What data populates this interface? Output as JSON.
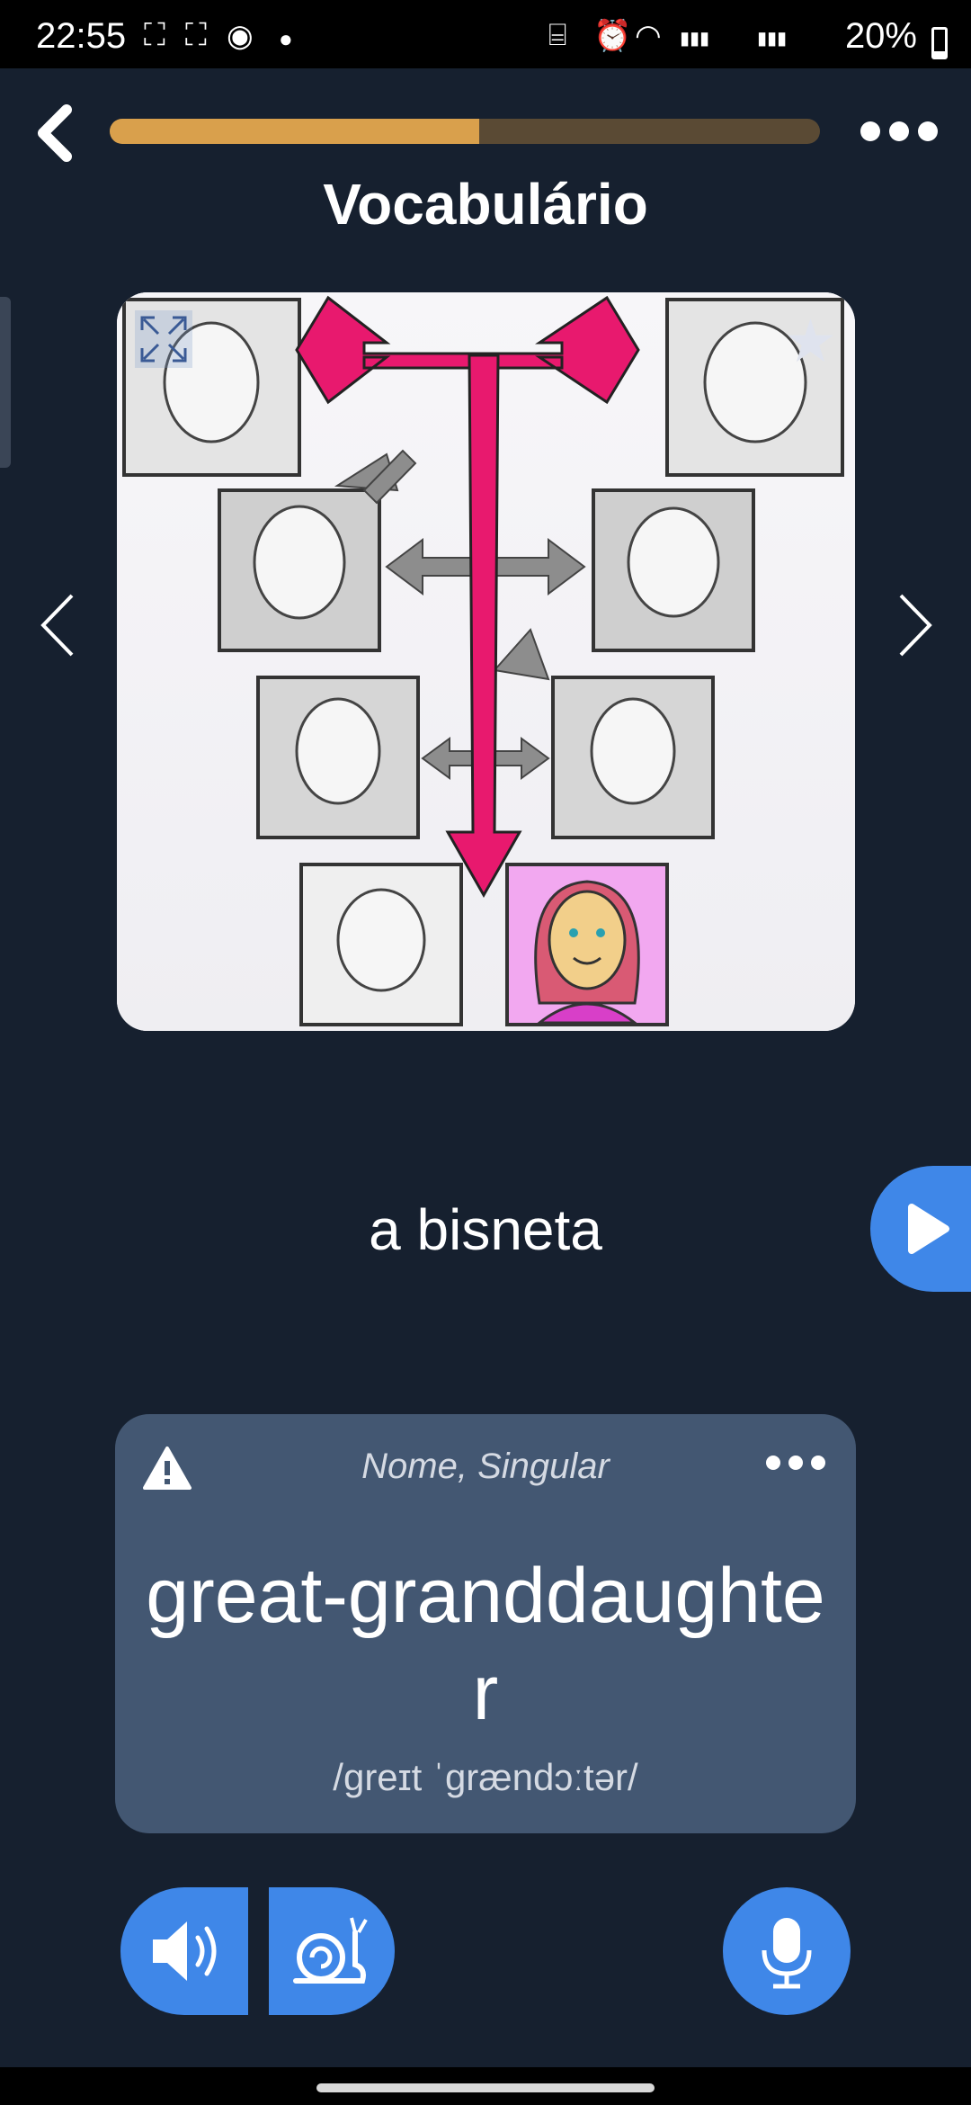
{
  "status_bar": {
    "time": "22:55",
    "battery": "20%",
    "battery_level": 0.2
  },
  "lesson": {
    "title": "Vocabulário",
    "progress": 0.52
  },
  "card": {
    "word": "a bisneta",
    "word_type": "Nome, Singular",
    "translation": "great-granddaughter",
    "phonetic": "/greɪt ˈgrændɔːtər/"
  },
  "colors": {
    "accent": "#3f87e8",
    "progress": "#d9a04c",
    "highlight_arrow": "#e8196e",
    "background": "#16202f",
    "card": "#435772"
  },
  "icons": {
    "back": "chevron-left-icon",
    "menu": "more-horizontal-icon",
    "expand": "expand-icon",
    "favorite": "star-icon",
    "prev": "chevron-left-icon",
    "next": "chevron-right-icon",
    "play": "play-icon",
    "warning": "warning-icon",
    "audio": "speaker-icon",
    "slow": "snail-icon",
    "mic": "microphone-icon"
  }
}
